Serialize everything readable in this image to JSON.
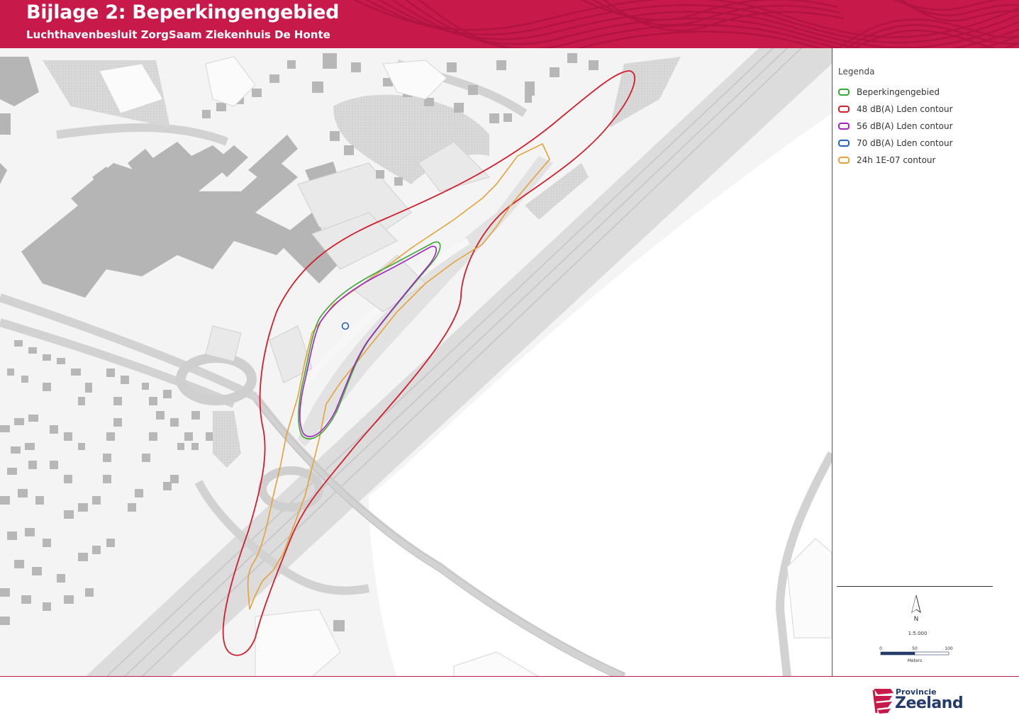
{
  "header": {
    "title": "Bijlage 2: Beperkingengebied",
    "subtitle": "Luchthavenbesluit ZorgSaam Ziekenhuis De Honte",
    "color": "#c8194b"
  },
  "legend": {
    "title": "Legenda",
    "items": [
      {
        "label": "Beperkingengebied",
        "color": "#3aa832"
      },
      {
        "label": "48 dB(A) Lden contour",
        "color": "#d21f2b"
      },
      {
        "label": "56 dB(A) Lden contour",
        "color": "#a324c2"
      },
      {
        "label": "70 dB(A) Lden contour",
        "color": "#2a62b5"
      },
      {
        "label": "24h 1E-07 contour",
        "color": "#e5a23a"
      }
    ]
  },
  "north_arrow": {
    "label": "N"
  },
  "scale": {
    "text": "1:5.000",
    "ticks": [
      "0",
      "50",
      "100"
    ],
    "unit": "Meters"
  },
  "logo": {
    "line1": "Provincie",
    "line2": "Zeeland",
    "color": "#233a6b"
  }
}
